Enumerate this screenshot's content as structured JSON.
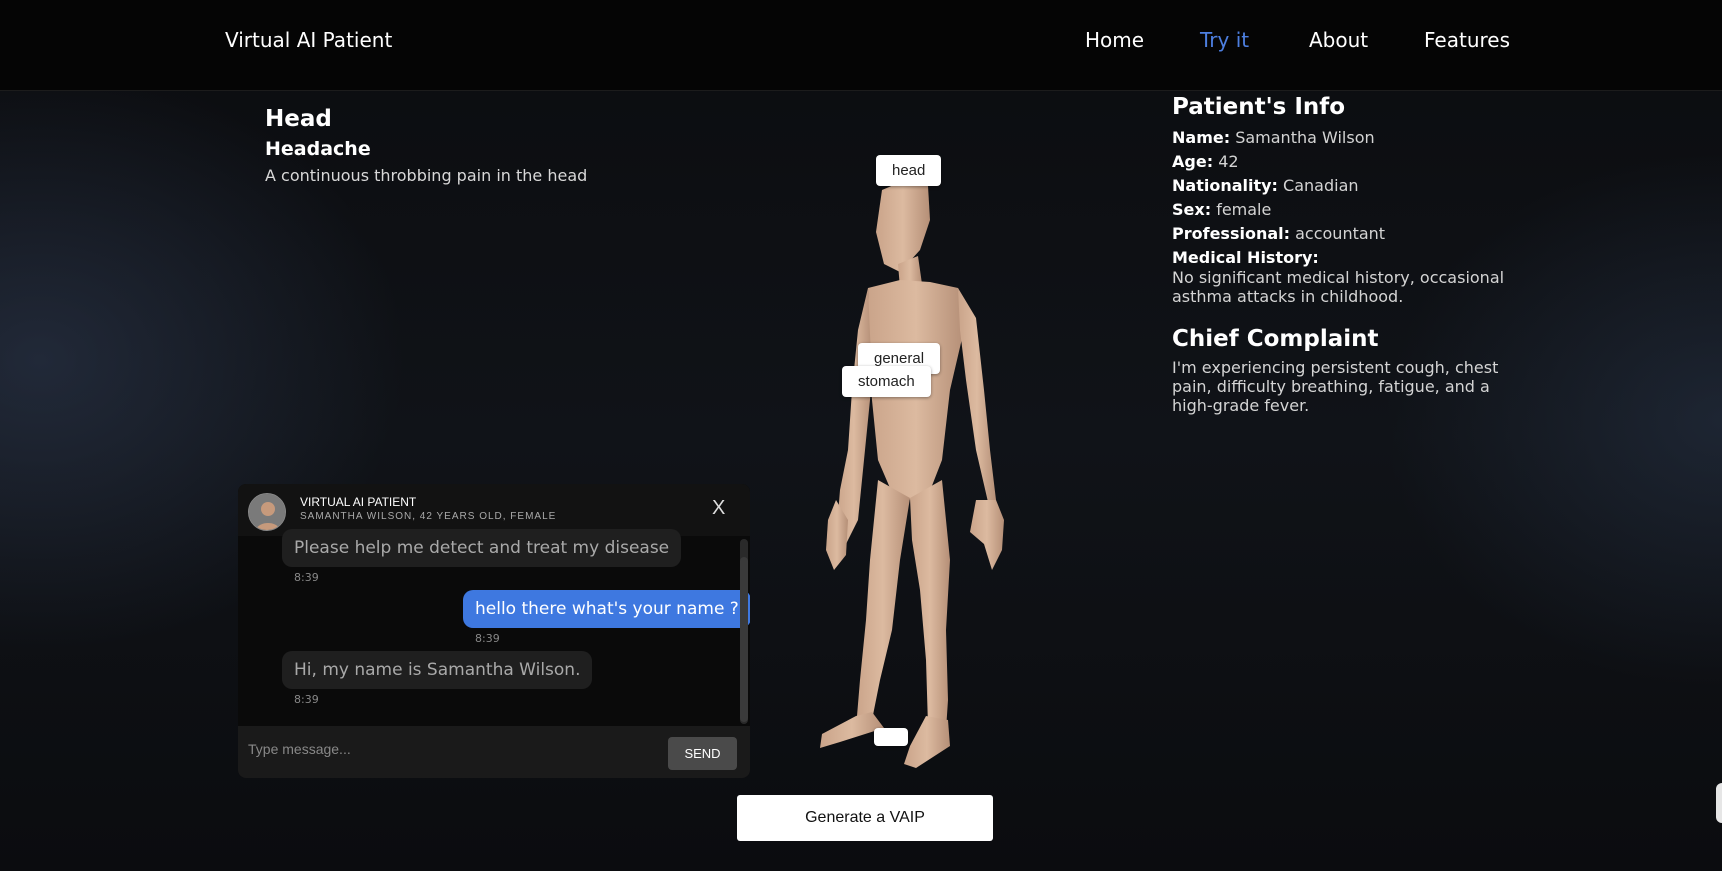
{
  "header": {
    "brand": "Virtual AI Patient",
    "nav": [
      {
        "label": "Home",
        "active": false
      },
      {
        "label": "Try it",
        "active": true
      },
      {
        "label": "About",
        "active": false
      },
      {
        "label": "Features",
        "active": false
      }
    ]
  },
  "symptom": {
    "region": "Head",
    "name": "Headache",
    "description": "A continuous throbbing pain in the head"
  },
  "figure": {
    "tags": {
      "head": "head",
      "general": "general",
      "stomach": "stomach",
      "feet": ""
    }
  },
  "patient": {
    "heading": "Patient's Info",
    "name_label": "Name:",
    "name": "Samantha Wilson",
    "age_label": "Age:",
    "age": "42",
    "nationality_label": "Nationality:",
    "nationality": "Canadian",
    "sex_label": "Sex:",
    "sex": "female",
    "professional_label": "Professional:",
    "professional": "accountant",
    "history_label": "Medical History:",
    "history": "No significant medical history, occasional asthma attacks in childhood.",
    "complaint_heading": "Chief Complaint",
    "complaint": "I'm experiencing persistent cough, chest pain, difficulty breathing, fatigue, and a high-grade fever."
  },
  "chat": {
    "title": "VIRTUAL AI PATIENT",
    "subtitle": "SAMANTHA WILSON, 42 YEARS OLD, FEMALE",
    "close_label": "X",
    "messages": [
      {
        "from": "patient",
        "text": "Please help me detect and treat my disease",
        "time": "8:39"
      },
      {
        "from": "user",
        "text": "hello there what's your name ?",
        "time": "8:39"
      },
      {
        "from": "patient",
        "text": "Hi, my name is Samantha Wilson.",
        "time": "8:39"
      }
    ],
    "input_placeholder": "Type message...",
    "send_label": "SEND"
  },
  "actions": {
    "generate_label": "Generate a VAIP"
  },
  "colors": {
    "accent": "#4d7fe0",
    "user_bubble": "#3e78e0",
    "skin": "#d9b59a"
  }
}
